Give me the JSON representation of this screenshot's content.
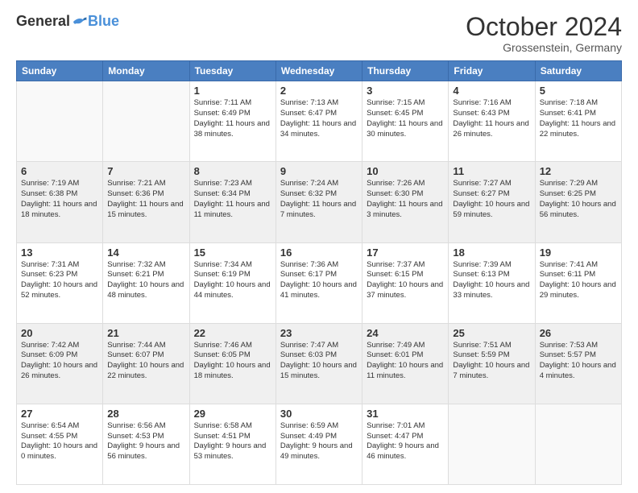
{
  "header": {
    "logo_general": "General",
    "logo_blue": "Blue",
    "month_title": "October 2024",
    "location": "Grossenstein, Germany"
  },
  "weekdays": [
    "Sunday",
    "Monday",
    "Tuesday",
    "Wednesday",
    "Thursday",
    "Friday",
    "Saturday"
  ],
  "weeks": [
    [
      {
        "day": "",
        "info": "",
        "empty": true
      },
      {
        "day": "",
        "info": "",
        "empty": true
      },
      {
        "day": "1",
        "info": "Sunrise: 7:11 AM\nSunset: 6:49 PM\nDaylight: 11 hours and 38 minutes.",
        "empty": false
      },
      {
        "day": "2",
        "info": "Sunrise: 7:13 AM\nSunset: 6:47 PM\nDaylight: 11 hours and 34 minutes.",
        "empty": false
      },
      {
        "day": "3",
        "info": "Sunrise: 7:15 AM\nSunset: 6:45 PM\nDaylight: 11 hours and 30 minutes.",
        "empty": false
      },
      {
        "day": "4",
        "info": "Sunrise: 7:16 AM\nSunset: 6:43 PM\nDaylight: 11 hours and 26 minutes.",
        "empty": false
      },
      {
        "day": "5",
        "info": "Sunrise: 7:18 AM\nSunset: 6:41 PM\nDaylight: 11 hours and 22 minutes.",
        "empty": false
      }
    ],
    [
      {
        "day": "6",
        "info": "Sunrise: 7:19 AM\nSunset: 6:38 PM\nDaylight: 11 hours and 18 minutes.",
        "empty": false
      },
      {
        "day": "7",
        "info": "Sunrise: 7:21 AM\nSunset: 6:36 PM\nDaylight: 11 hours and 15 minutes.",
        "empty": false
      },
      {
        "day": "8",
        "info": "Sunrise: 7:23 AM\nSunset: 6:34 PM\nDaylight: 11 hours and 11 minutes.",
        "empty": false
      },
      {
        "day": "9",
        "info": "Sunrise: 7:24 AM\nSunset: 6:32 PM\nDaylight: 11 hours and 7 minutes.",
        "empty": false
      },
      {
        "day": "10",
        "info": "Sunrise: 7:26 AM\nSunset: 6:30 PM\nDaylight: 11 hours and 3 minutes.",
        "empty": false
      },
      {
        "day": "11",
        "info": "Sunrise: 7:27 AM\nSunset: 6:27 PM\nDaylight: 10 hours and 59 minutes.",
        "empty": false
      },
      {
        "day": "12",
        "info": "Sunrise: 7:29 AM\nSunset: 6:25 PM\nDaylight: 10 hours and 56 minutes.",
        "empty": false
      }
    ],
    [
      {
        "day": "13",
        "info": "Sunrise: 7:31 AM\nSunset: 6:23 PM\nDaylight: 10 hours and 52 minutes.",
        "empty": false
      },
      {
        "day": "14",
        "info": "Sunrise: 7:32 AM\nSunset: 6:21 PM\nDaylight: 10 hours and 48 minutes.",
        "empty": false
      },
      {
        "day": "15",
        "info": "Sunrise: 7:34 AM\nSunset: 6:19 PM\nDaylight: 10 hours and 44 minutes.",
        "empty": false
      },
      {
        "day": "16",
        "info": "Sunrise: 7:36 AM\nSunset: 6:17 PM\nDaylight: 10 hours and 41 minutes.",
        "empty": false
      },
      {
        "day": "17",
        "info": "Sunrise: 7:37 AM\nSunset: 6:15 PM\nDaylight: 10 hours and 37 minutes.",
        "empty": false
      },
      {
        "day": "18",
        "info": "Sunrise: 7:39 AM\nSunset: 6:13 PM\nDaylight: 10 hours and 33 minutes.",
        "empty": false
      },
      {
        "day": "19",
        "info": "Sunrise: 7:41 AM\nSunset: 6:11 PM\nDaylight: 10 hours and 29 minutes.",
        "empty": false
      }
    ],
    [
      {
        "day": "20",
        "info": "Sunrise: 7:42 AM\nSunset: 6:09 PM\nDaylight: 10 hours and 26 minutes.",
        "empty": false
      },
      {
        "day": "21",
        "info": "Sunrise: 7:44 AM\nSunset: 6:07 PM\nDaylight: 10 hours and 22 minutes.",
        "empty": false
      },
      {
        "day": "22",
        "info": "Sunrise: 7:46 AM\nSunset: 6:05 PM\nDaylight: 10 hours and 18 minutes.",
        "empty": false
      },
      {
        "day": "23",
        "info": "Sunrise: 7:47 AM\nSunset: 6:03 PM\nDaylight: 10 hours and 15 minutes.",
        "empty": false
      },
      {
        "day": "24",
        "info": "Sunrise: 7:49 AM\nSunset: 6:01 PM\nDaylight: 10 hours and 11 minutes.",
        "empty": false
      },
      {
        "day": "25",
        "info": "Sunrise: 7:51 AM\nSunset: 5:59 PM\nDaylight: 10 hours and 7 minutes.",
        "empty": false
      },
      {
        "day": "26",
        "info": "Sunrise: 7:53 AM\nSunset: 5:57 PM\nDaylight: 10 hours and 4 minutes.",
        "empty": false
      }
    ],
    [
      {
        "day": "27",
        "info": "Sunrise: 6:54 AM\nSunset: 4:55 PM\nDaylight: 10 hours and 0 minutes.",
        "empty": false
      },
      {
        "day": "28",
        "info": "Sunrise: 6:56 AM\nSunset: 4:53 PM\nDaylight: 9 hours and 56 minutes.",
        "empty": false
      },
      {
        "day": "29",
        "info": "Sunrise: 6:58 AM\nSunset: 4:51 PM\nDaylight: 9 hours and 53 minutes.",
        "empty": false
      },
      {
        "day": "30",
        "info": "Sunrise: 6:59 AM\nSunset: 4:49 PM\nDaylight: 9 hours and 49 minutes.",
        "empty": false
      },
      {
        "day": "31",
        "info": "Sunrise: 7:01 AM\nSunset: 4:47 PM\nDaylight: 9 hours and 46 minutes.",
        "empty": false
      },
      {
        "day": "",
        "info": "",
        "empty": true
      },
      {
        "day": "",
        "info": "",
        "empty": true
      }
    ]
  ]
}
